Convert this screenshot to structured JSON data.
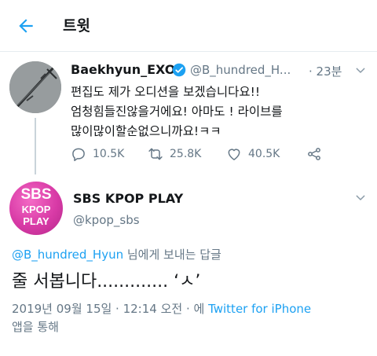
{
  "header": {
    "title": "트윗"
  },
  "parent_tweet": {
    "display_name": "Baekhyun_EXO",
    "handle": "@B_hundred_H...",
    "time": "· 23분",
    "lines": [
      "편집도 제가 오디션을 보겠습니다요!!",
      "엄청힘들진않을거에요! 아마도 ! 라이브를",
      "많이많이할순없으니까요!ㅋㅋ"
    ],
    "actions": {
      "reply_count": "10.5K",
      "retweet_count": "25.8K",
      "like_count": "40.5K"
    }
  },
  "reply_tweet": {
    "display_name": "SBS KPOP PLAY",
    "handle": "@kpop_sbs",
    "avatar_text": [
      "SBS",
      "KPOP",
      "PLAY"
    ],
    "replying_to_handle": "@B_hundred_Hyun",
    "replying_to_suffix": " 님에게 보내는 답글",
    "text": "줄 서봅니다............. ‘ㅅ’",
    "date_time": "2019년 09월 15일 · 12:14 오전 · 에 ",
    "source": "Twitter for iPhone",
    "via_suffix": "앱을 통해"
  },
  "colors": {
    "accent": "#1da1f2",
    "muted": "#657786",
    "text": "#14171a",
    "brand_pink": "#d83aa6"
  }
}
